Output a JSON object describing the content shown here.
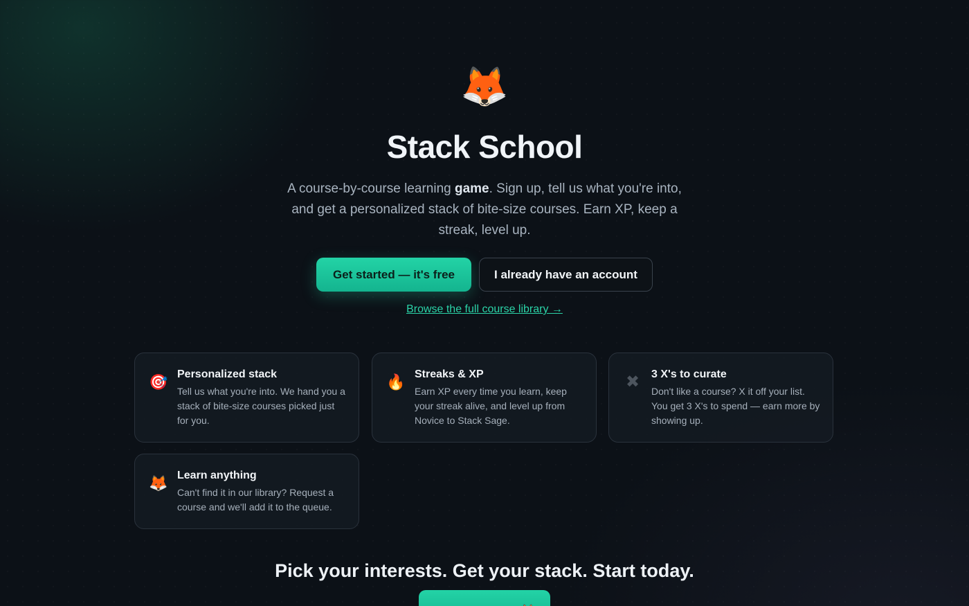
{
  "hero": {
    "logo_emoji": "🦊",
    "logo_icon": "fox-icon",
    "title": "Stack School",
    "lead_part1": "A course-by-course learning ",
    "lead_bold": "game",
    "lead_part2": ". Sign up, tell us what you're into, and get a personalized stack of bite-size courses. Earn XP, keep a streak, level up.",
    "primary_button": "Get started — it's free",
    "secondary_button": "I already have an account",
    "browse_link": "Browse the full course library →"
  },
  "features": [
    {
      "icon": "target-icon",
      "glyph": "🎯",
      "title": "Personalized stack",
      "body": "Tell us what you're into. We hand you a stack of bite-size courses picked just for you."
    },
    {
      "icon": "fire-icon",
      "glyph": "🔥",
      "title": "Streaks & XP",
      "body": "Earn XP every time you learn, keep your streak alive, and level up from Novice to Stack Sage."
    },
    {
      "icon": "x-mark-icon",
      "glyph": "✖",
      "title": "3 X's to curate",
      "body": "Don't like a course? X it off your list. You get 3 X's to spend — earn more by showing up."
    },
    {
      "icon": "fox-icon",
      "glyph": "🦊",
      "title": "Learn anything",
      "body": "Can't find it in our library? Request a course and we'll add it to the queue."
    }
  ],
  "cta": {
    "heading": "Pick your interests. Get your stack. Start today.",
    "button": "Build my stack 🦊"
  },
  "colors": {
    "accent": "#23d3a6",
    "background": "#0c1117",
    "card_background": "#141a22",
    "card_border": "#2a323c",
    "link": "#2bd4a8"
  }
}
